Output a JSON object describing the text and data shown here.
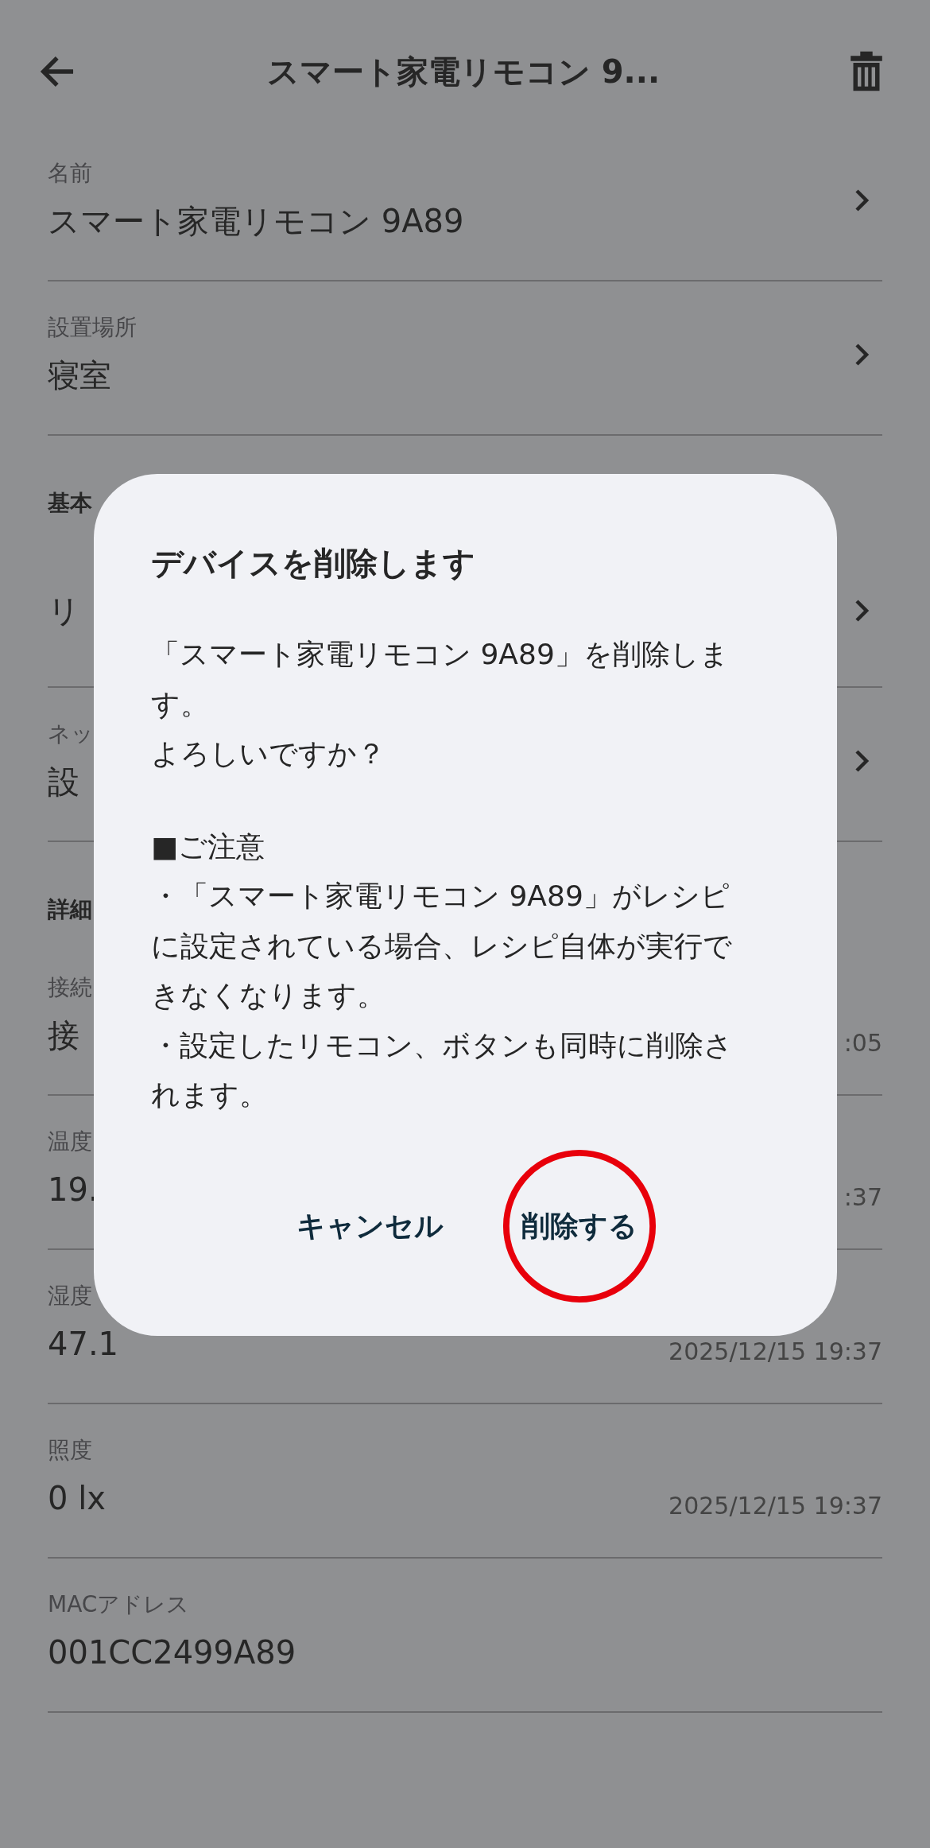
{
  "header": {
    "title": "スマート家電リモコン 9..."
  },
  "rows": [
    {
      "kind": "field",
      "label": "名前",
      "value": "スマート家電リモコン 9A89",
      "chevron": true
    },
    {
      "kind": "field",
      "label": "設置場所",
      "value": "寝室",
      "chevron": true
    },
    {
      "kind": "section",
      "label": "基本"
    },
    {
      "kind": "value",
      "value": "リ",
      "chevron": true
    },
    {
      "kind": "field",
      "label": "ネッ",
      "value": "設",
      "chevron": true
    },
    {
      "kind": "section",
      "label": "詳細"
    },
    {
      "kind": "field",
      "label": "接続",
      "value": "接",
      "time": ":05"
    },
    {
      "kind": "field",
      "label": "温度",
      "value": "19.",
      "time": ":37"
    },
    {
      "kind": "field",
      "label": "湿度",
      "value": "47.1",
      "time": "2025/12/15 19:37"
    },
    {
      "kind": "field",
      "label": "照度",
      "value": "0 lx",
      "time": "2025/12/15 19:37"
    },
    {
      "kind": "field",
      "label": "MACアドレス",
      "value": "001CC2499A89"
    }
  ],
  "dialog": {
    "title": "デバイスを削除します",
    "message": [
      "「スマート家電リモコン 9A89」を削除します。",
      "よろしいですか？"
    ],
    "notice_title": "■ご注意",
    "notices": [
      "・「スマート家電リモコン 9A89」がレシピに設定されている場合、レシピ自体が実行できなくなります。",
      "・設定したリモコン、ボタンも同時に削除されます。"
    ],
    "buttons": [
      {
        "label": "キャンセル",
        "circled": false
      },
      {
        "label": "削除する",
        "circled": true
      }
    ]
  }
}
